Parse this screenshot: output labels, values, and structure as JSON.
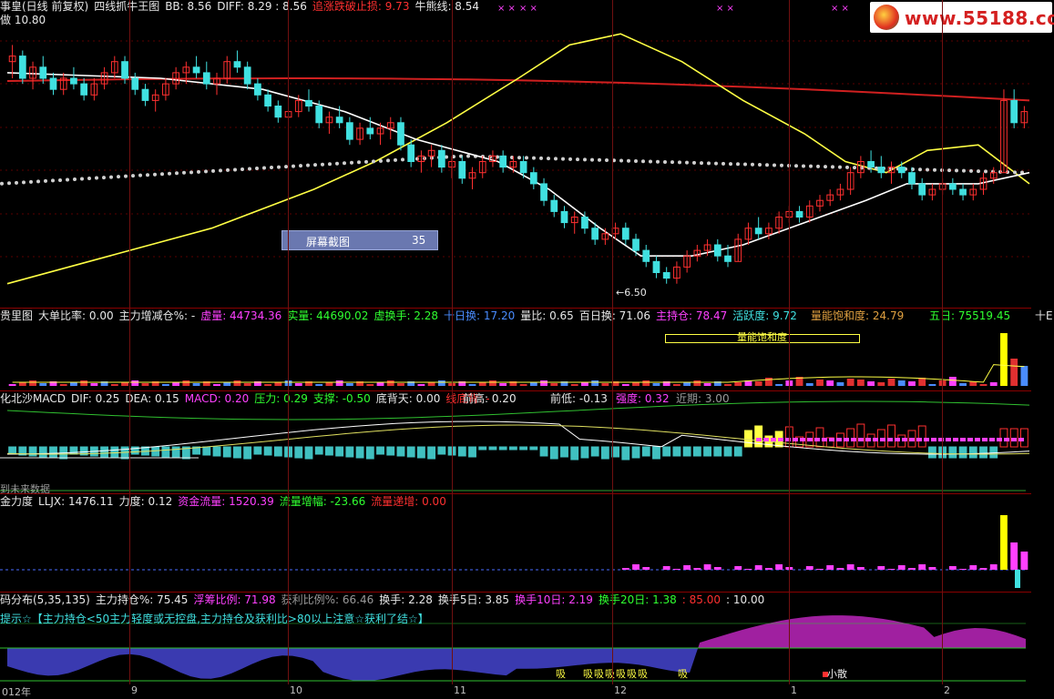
{
  "main_header": [
    {
      "text": "事皇(日线 前复权)",
      "color": "white"
    },
    {
      "text": "四线抓牛王图",
      "color": "white"
    },
    {
      "text": "BB: 8.56",
      "color": "white"
    },
    {
      "text": "DIFF: 8.29 : 8.56",
      "color": "white"
    },
    {
      "text": "追涨跌破止损: 9.73",
      "color": "red"
    },
    {
      "text": "牛熊线: 8.54",
      "color": "white"
    }
  ],
  "main_subheader": "做 10.80",
  "low_marker": "←6.50",
  "logo_text": "www.55188.com",
  "overlay_box": {
    "label": "屏幕截图",
    "value": "35"
  },
  "vol_header": [
    {
      "text": "贵里图",
      "color": "white"
    },
    {
      "text": "大单比率: 0.00",
      "color": "white"
    },
    {
      "text": "主力增减仓%: -",
      "color": "white"
    },
    {
      "text": "虚量: 44734.36",
      "color": "magenta"
    },
    {
      "text": "实量: 44690.02",
      "color": "green"
    },
    {
      "text": "虚换手: 2.28",
      "color": "green"
    },
    {
      "text": "十日换: 17.20",
      "color": "blue"
    },
    {
      "text": "量比: 0.65",
      "color": "white"
    },
    {
      "text": "百日换: 71.06",
      "color": "white"
    },
    {
      "text": "主持仓: 78.47",
      "color": "magenta"
    },
    {
      "text": "活跃度: 9.72",
      "color": "cyan"
    },
    {
      "text": "量能饱和度: 24.79",
      "color": "orange"
    },
    {
      "text": "五日: 75519.45",
      "color": "green"
    },
    {
      "text": "十E",
      "color": "white"
    }
  ],
  "vol_box_label": "量能饱和度",
  "macd_header": [
    {
      "text": "化北沙MACD",
      "color": "white"
    },
    {
      "text": "DIF: 0.25",
      "color": "white"
    },
    {
      "text": "DEA: 0.15",
      "color": "white"
    },
    {
      "text": "MACD: 0.20",
      "color": "magenta"
    },
    {
      "text": "压力: 0.29",
      "color": "green"
    },
    {
      "text": "支撑: -0.50",
      "color": "green"
    },
    {
      "text": "底背天: 0.00",
      "color": "white"
    },
    {
      "text": "线底背: -",
      "color": "red"
    },
    {
      "text": "前高: 0.20",
      "color": "white"
    },
    {
      "text": "前低: -0.13",
      "color": "white"
    },
    {
      "text": "强度: 0.32",
      "color": "magenta"
    },
    {
      "text": "近期: 3.00",
      "color": "gray"
    }
  ],
  "macd_footer": "到未来数据",
  "flow_header": [
    {
      "text": "金力度",
      "color": "white"
    },
    {
      "text": "LLJX: 1476.11",
      "color": "white"
    },
    {
      "text": "力度: 0.12",
      "color": "white"
    },
    {
      "text": "资金流量: 1520.39",
      "color": "magenta"
    },
    {
      "text": "流量增幅: -23.66",
      "color": "green"
    },
    {
      "text": "流量递增: 0.00",
      "color": "red"
    }
  ],
  "chip_header": [
    {
      "text": "码分布(5,35,135)",
      "color": "white"
    },
    {
      "text": "主力持仓%: 75.45",
      "color": "white"
    },
    {
      "text": "浮筹比例: 71.98",
      "color": "magenta"
    },
    {
      "text": "获利比例%: 66.46",
      "color": "gray"
    },
    {
      "text": "换手: 2.28",
      "color": "white"
    },
    {
      "text": "换手5日: 3.85",
      "color": "white"
    },
    {
      "text": "换手10日: 2.19",
      "color": "magenta"
    },
    {
      "text": "换手20日: 1.38",
      "color": "green"
    },
    {
      "text": ": 85.00",
      "color": "red"
    },
    {
      "text": ": 10.00",
      "color": "white"
    }
  ],
  "chip_tip": "提示☆【主力持仓<50主力轻度或无控盘,主力持仓及获利比>80以上注意☆获利了结☆】",
  "chip_annotation": "小散",
  "xaxis_labels": [
    "012年",
    "9",
    "10",
    "11",
    "12",
    "1",
    "2"
  ],
  "colors": {
    "up": "#ff3030",
    "down": "#40e0e0",
    "bg": "#000000",
    "ma_white": "#ffffff",
    "ma_yellow": "#ffff44",
    "ma_red": "#d02020",
    "dotted": "#d0d0d0"
  },
  "chart_data": {
    "type": "candlestick",
    "title": "四线抓牛王图",
    "ylim": [
      6.2,
      11.2
    ],
    "low_point": 6.5,
    "series": [
      {
        "name": "BB",
        "values": [
          8.56
        ]
      },
      {
        "name": "牛熊线",
        "values": [
          8.54
        ]
      },
      {
        "name": "追涨跌破止损",
        "values": [
          9.73
        ]
      }
    ],
    "candles": [
      [
        10.5,
        10.8,
        10.2,
        10.6
      ],
      [
        10.6,
        10.7,
        10.1,
        10.2
      ],
      [
        10.2,
        10.5,
        10.0,
        10.4
      ],
      [
        10.4,
        10.6,
        10.1,
        10.2
      ],
      [
        10.2,
        10.3,
        9.9,
        10.0
      ],
      [
        10.0,
        10.3,
        9.9,
        10.2
      ],
      [
        10.2,
        10.4,
        10.0,
        10.1
      ],
      [
        10.1,
        10.2,
        9.8,
        9.9
      ],
      [
        9.9,
        10.2,
        9.8,
        10.1
      ],
      [
        10.1,
        10.4,
        10.0,
        10.3
      ],
      [
        10.3,
        10.6,
        10.2,
        10.5
      ],
      [
        10.5,
        10.6,
        10.1,
        10.2
      ],
      [
        10.2,
        10.3,
        9.9,
        10.0
      ],
      [
        10.0,
        10.1,
        9.7,
        9.8
      ],
      [
        9.8,
        10.0,
        9.6,
        9.9
      ],
      [
        9.9,
        10.2,
        9.8,
        10.1
      ],
      [
        10.1,
        10.4,
        10.0,
        10.3
      ],
      [
        10.3,
        10.5,
        10.1,
        10.4
      ],
      [
        10.4,
        10.6,
        10.2,
        10.3
      ],
      [
        10.3,
        10.5,
        10.0,
        10.1
      ],
      [
        10.1,
        10.3,
        9.9,
        10.2
      ],
      [
        10.2,
        10.6,
        10.1,
        10.5
      ],
      [
        10.5,
        10.7,
        10.3,
        10.4
      ],
      [
        10.4,
        10.5,
        10.0,
        10.1
      ],
      [
        10.1,
        10.2,
        9.8,
        9.9
      ],
      [
        9.9,
        10.0,
        9.6,
        9.7
      ],
      [
        9.7,
        9.8,
        9.4,
        9.5
      ],
      [
        9.5,
        9.7,
        9.3,
        9.6
      ],
      [
        9.6,
        9.9,
        9.5,
        9.8
      ],
      [
        9.8,
        10.0,
        9.6,
        9.7
      ],
      [
        9.7,
        9.8,
        9.3,
        9.4
      ],
      [
        9.4,
        9.6,
        9.2,
        9.5
      ],
      [
        9.5,
        9.7,
        9.3,
        9.4
      ],
      [
        9.4,
        9.5,
        9.0,
        9.1
      ],
      [
        9.1,
        9.4,
        9.0,
        9.3
      ],
      [
        9.3,
        9.5,
        9.1,
        9.2
      ],
      [
        9.2,
        9.4,
        9.0,
        9.3
      ],
      [
        9.3,
        9.5,
        9.1,
        9.4
      ],
      [
        9.4,
        9.5,
        8.9,
        9.0
      ],
      [
        9.0,
        9.1,
        8.6,
        8.7
      ],
      [
        8.7,
        8.9,
        8.5,
        8.8
      ],
      [
        8.8,
        9.0,
        8.6,
        8.9
      ],
      [
        8.9,
        9.0,
        8.5,
        8.6
      ],
      [
        8.6,
        8.8,
        8.4,
        8.7
      ],
      [
        8.7,
        8.8,
        8.3,
        8.4
      ],
      [
        8.4,
        8.6,
        8.2,
        8.5
      ],
      [
        8.5,
        8.8,
        8.4,
        8.7
      ],
      [
        8.7,
        8.9,
        8.6,
        8.8
      ],
      [
        8.8,
        8.9,
        8.5,
        8.6
      ],
      [
        8.6,
        8.8,
        8.5,
        8.7
      ],
      [
        8.7,
        8.8,
        8.4,
        8.5
      ],
      [
        8.5,
        8.6,
        8.2,
        8.3
      ],
      [
        8.3,
        8.4,
        7.9,
        8.0
      ],
      [
        8.0,
        8.1,
        7.7,
        7.8
      ],
      [
        7.8,
        7.9,
        7.5,
        7.6
      ],
      [
        7.6,
        7.8,
        7.4,
        7.7
      ],
      [
        7.7,
        7.8,
        7.4,
        7.5
      ],
      [
        7.5,
        7.6,
        7.2,
        7.3
      ],
      [
        7.3,
        7.5,
        7.2,
        7.4
      ],
      [
        7.4,
        7.6,
        7.3,
        7.5
      ],
      [
        7.5,
        7.6,
        7.2,
        7.3
      ],
      [
        7.3,
        7.4,
        7.0,
        7.1
      ],
      [
        7.1,
        7.2,
        6.8,
        6.9
      ],
      [
        6.9,
        7.0,
        6.6,
        6.7
      ],
      [
        6.7,
        6.8,
        6.5,
        6.6
      ],
      [
        6.6,
        6.9,
        6.5,
        6.8
      ],
      [
        6.8,
        7.1,
        6.7,
        7.0
      ],
      [
        7.0,
        7.2,
        6.9,
        7.1
      ],
      [
        7.1,
        7.3,
        7.0,
        7.2
      ],
      [
        7.2,
        7.3,
        6.9,
        7.0
      ],
      [
        7.0,
        7.2,
        6.8,
        6.9
      ],
      [
        6.9,
        7.4,
        6.9,
        7.3
      ],
      [
        7.3,
        7.6,
        7.2,
        7.5
      ],
      [
        7.5,
        7.7,
        7.3,
        7.4
      ],
      [
        7.4,
        7.6,
        7.3,
        7.5
      ],
      [
        7.5,
        7.8,
        7.4,
        7.7
      ],
      [
        7.7,
        7.9,
        7.6,
        7.8
      ],
      [
        7.8,
        7.9,
        7.6,
        7.7
      ],
      [
        7.7,
        8.0,
        7.6,
        7.9
      ],
      [
        7.9,
        8.1,
        7.8,
        8.0
      ],
      [
        8.0,
        8.2,
        7.9,
        8.1
      ],
      [
        8.1,
        8.3,
        8.0,
        8.2
      ],
      [
        8.2,
        8.6,
        8.1,
        8.5
      ],
      [
        8.5,
        8.8,
        8.4,
        8.7
      ],
      [
        8.7,
        8.9,
        8.5,
        8.6
      ],
      [
        8.6,
        8.8,
        8.4,
        8.5
      ],
      [
        8.5,
        8.7,
        8.3,
        8.6
      ],
      [
        8.6,
        8.7,
        8.4,
        8.5
      ],
      [
        8.5,
        8.6,
        8.2,
        8.3
      ],
      [
        8.3,
        8.4,
        8.0,
        8.1
      ],
      [
        8.1,
        8.3,
        8.0,
        8.2
      ],
      [
        8.2,
        8.4,
        8.1,
        8.3
      ],
      [
        8.3,
        8.4,
        8.1,
        8.2
      ],
      [
        8.2,
        8.3,
        8.0,
        8.1
      ],
      [
        8.1,
        8.3,
        8.0,
        8.2
      ],
      [
        8.2,
        8.5,
        8.1,
        8.4
      ],
      [
        8.4,
        8.6,
        8.3,
        8.5
      ],
      [
        8.5,
        10.0,
        8.5,
        9.8
      ],
      [
        9.8,
        10.0,
        9.3,
        9.4
      ],
      [
        9.4,
        9.7,
        9.3,
        9.6
      ]
    ]
  }
}
